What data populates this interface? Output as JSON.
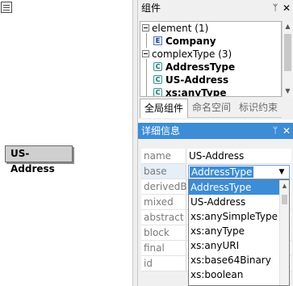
{
  "canvas": {
    "node_label": "US-Address"
  },
  "components_panel": {
    "title": "组件",
    "pin_glyph": "ᛘ",
    "close_glyph": "✕",
    "tree": [
      {
        "label": "element (1)",
        "children": [
          {
            "icon": "E",
            "label": "Company"
          }
        ]
      },
      {
        "label": "complexType (3)",
        "children": [
          {
            "icon": "C",
            "label": "AddressType"
          },
          {
            "icon": "C",
            "label": "US-Address"
          },
          {
            "icon": "C",
            "label": "xs:anyType"
          }
        ]
      }
    ],
    "tabs": [
      "全局组件",
      "命名空间",
      "标识约束"
    ]
  },
  "details_panel": {
    "title": "详细信息",
    "pin_glyph": "ᛘ",
    "close_glyph": "✕",
    "properties": [
      {
        "name": "name",
        "value": "US-Address"
      },
      {
        "name": "base",
        "value": "AddressType"
      },
      {
        "name": "derivedBy",
        "value": ""
      },
      {
        "name": "mixed",
        "value": ""
      },
      {
        "name": "abstract",
        "value": ""
      },
      {
        "name": "block",
        "value": ""
      },
      {
        "name": "final",
        "value": ""
      },
      {
        "name": "id",
        "value": ""
      }
    ],
    "base_dropdown": {
      "selected": "AddressType",
      "options": [
        "AddressType",
        "US-Address",
        "xs:anySimpleType",
        "xs:anyType",
        "xs:anyURI",
        "xs:base64Binary",
        "xs:boolean"
      ]
    }
  },
  "colors": {
    "accent": "#3c8cd6"
  }
}
